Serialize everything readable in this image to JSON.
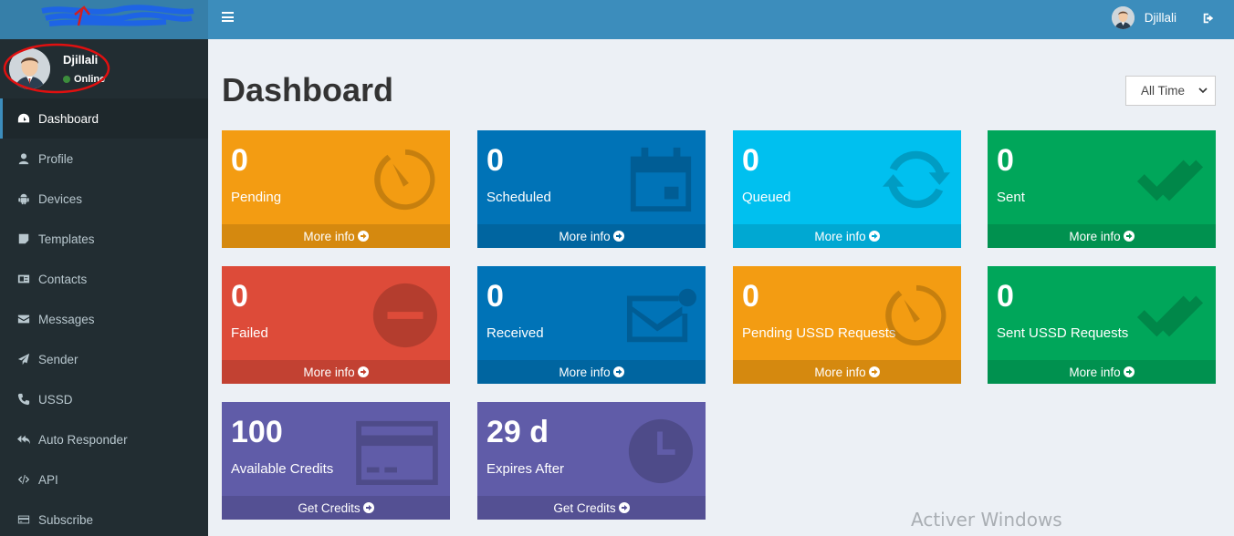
{
  "sidebar": {
    "user": {
      "name": "Djillali",
      "status": "Online"
    },
    "items": [
      {
        "label": "Dashboard",
        "icon": "dashboard-icon",
        "active": true
      },
      {
        "label": "Profile",
        "icon": "user-icon"
      },
      {
        "label": "Devices",
        "icon": "android-icon"
      },
      {
        "label": "Templates",
        "icon": "sticky-note-icon"
      },
      {
        "label": "Contacts",
        "icon": "address-card-icon"
      },
      {
        "label": "Messages",
        "icon": "envelope-icon"
      },
      {
        "label": "Sender",
        "icon": "paper-plane-icon"
      },
      {
        "label": "USSD",
        "icon": "phone-icon"
      },
      {
        "label": "Auto Responder",
        "icon": "reply-all-icon"
      },
      {
        "label": "API",
        "icon": "code-icon"
      },
      {
        "label": "Subscribe",
        "icon": "credit-card-icon"
      }
    ]
  },
  "header": {
    "user_name": "Djillali"
  },
  "main": {
    "title": "Dashboard",
    "time_filter": {
      "selected": "All Time"
    },
    "boxes": [
      {
        "value": "0",
        "label": "Pending",
        "footer": "More info",
        "color": "#f39c12",
        "icon": "timer-icon"
      },
      {
        "value": "0",
        "label": "Scheduled",
        "footer": "More info",
        "color": "#0073b7",
        "icon": "calendar-icon"
      },
      {
        "value": "0",
        "label": "Queued",
        "footer": "More info",
        "color": "#00c0ef",
        "icon": "refresh-icon"
      },
      {
        "value": "0",
        "label": "Sent",
        "footer": "More info",
        "color": "#00a65a",
        "icon": "double-check-icon"
      },
      {
        "value": "0",
        "label": "Failed",
        "footer": "More info",
        "color": "#dd4b39",
        "icon": "minus-circle-icon"
      },
      {
        "value": "0",
        "label": "Received",
        "footer": "More info",
        "color": "#0073b7",
        "icon": "envelope-icon"
      },
      {
        "value": "0",
        "label": "Pending USSD Requests",
        "footer": "More info",
        "color": "#f39c12",
        "icon": "timer-icon"
      },
      {
        "value": "0",
        "label": "Sent USSD Requests",
        "footer": "More info",
        "color": "#00a65a",
        "icon": "double-check-icon"
      },
      {
        "value": "100",
        "label": "Available Credits",
        "footer": "Get Credits",
        "color": "#605ca8",
        "icon": "credit-card-icon"
      },
      {
        "value": "29 d",
        "label": "Expires After",
        "footer": "Get Credits",
        "color": "#605ca8",
        "icon": "clock-icon"
      }
    ]
  },
  "watermark": "Activer Windows"
}
